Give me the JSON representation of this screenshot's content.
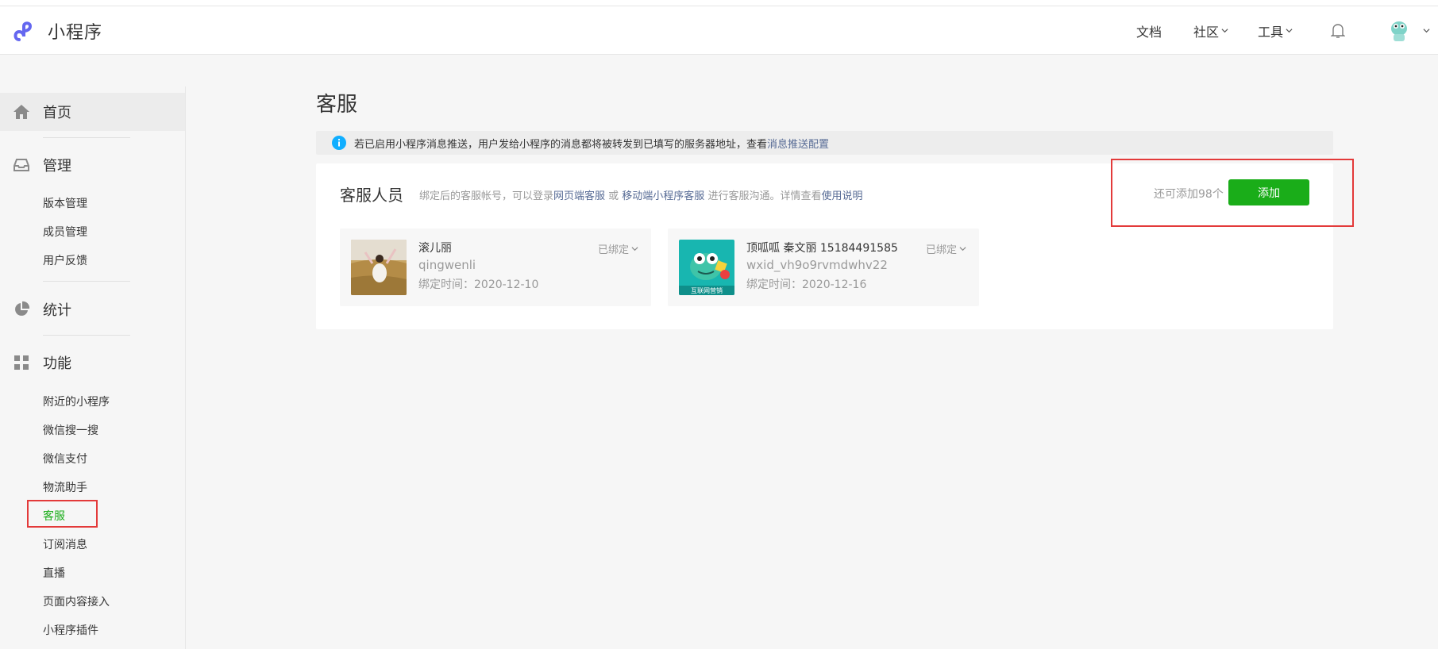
{
  "app": {
    "logo_text": "小程序"
  },
  "nav": {
    "docs": "文档",
    "community": "社区",
    "tools": "工具"
  },
  "sidebar": {
    "home": "首页",
    "manage": "管理",
    "manage_items": [
      "版本管理",
      "成员管理",
      "用户反馈"
    ],
    "stats": "统计",
    "features": "功能",
    "feature_items": [
      "附近的小程序",
      "微信搜一搜",
      "微信支付",
      "物流助手",
      "客服",
      "订阅消息",
      "直播",
      "页面内容接入",
      "小程序插件"
    ]
  },
  "main": {
    "title": "客服",
    "notice_text": "若已启用小程序消息推送，用户发给小程序的消息都将被转发到已填写的服务器地址，查看 ",
    "notice_link": "消息推送配置",
    "card": {
      "title": "客服人员",
      "desc_1": "绑定后的客服帐号，可以登录",
      "link_web": "网页端客服",
      "desc_2": " 或 ",
      "link_mobile": "移动端小程序客服",
      "desc_3": " 进行客服沟通。详情查看",
      "link_guide": "使用说明",
      "remain": "还可添加98个",
      "add_label": "添加"
    },
    "staff": [
      {
        "name": "滚儿丽",
        "account": "qingwenli",
        "bind_time": "绑定时间：2020-12-10",
        "status": "已绑定"
      },
      {
        "name": "顶呱呱 秦文丽 15184491585",
        "account": "wxid_vh9o9rvmdwhv22",
        "bind_time": "绑定时间：2020-12-16",
        "status": "已绑定",
        "avatar_caption": "互联网营销"
      }
    ]
  },
  "colors": {
    "accent": "#1aad19",
    "link": "#576b95",
    "highlight": "#e33a3a"
  }
}
